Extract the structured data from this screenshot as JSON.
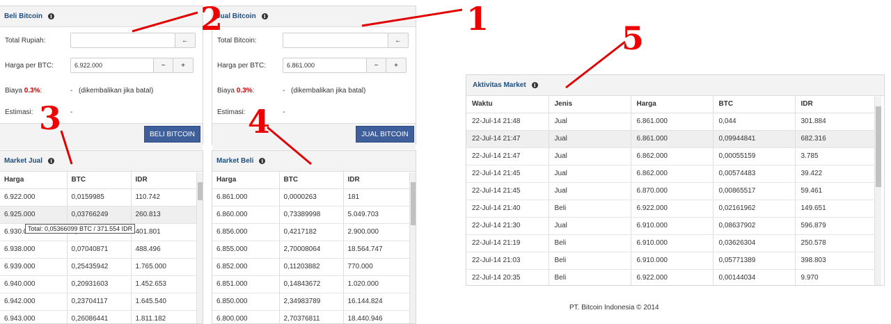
{
  "buy": {
    "title": "Beli Bitcoin",
    "total_label": "Total Rupiah:",
    "total_value": "",
    "price_label": "Harga per BTC:",
    "price_value": "6.922.000",
    "fee_label": "Biaya",
    "fee_pct": "0.3%",
    "fee_colon": ":",
    "fee_value": "-",
    "fee_note": "(dikembalikan jika batal)",
    "estimate_label": "Estimasi:",
    "estimate_value": "-",
    "button": "BELI BITCOIN"
  },
  "sell": {
    "title": "Jual Bitcoin",
    "total_label": "Total Bitcoin:",
    "total_value": "",
    "price_label": "Harga per BTC:",
    "price_value": "6.861.000",
    "fee_label": "Biaya",
    "fee_pct": "0.3%",
    "fee_colon": ":",
    "fee_value": "-",
    "fee_note": "(dikembalikan jika batal)",
    "estimate_label": "Estimasi:",
    "estimate_value": "-",
    "button": "JUAL BITCOIN"
  },
  "controls": {
    "arrow": "←",
    "minus": "−",
    "plus": "+",
    "info": "i"
  },
  "market_sell": {
    "title": "Market Jual",
    "headers": [
      "Harga",
      "BTC",
      "IDR"
    ],
    "rows": [
      [
        "6.922.000",
        "0,0159985",
        "110.742"
      ],
      [
        "6.925.000",
        "0,03766249",
        "260.813"
      ],
      [
        "6.930.000",
        "0,05366099",
        "401.801"
      ],
      [
        "6.938.000",
        "0,07040871",
        "488.496"
      ],
      [
        "6.939.000",
        "0,25435942",
        "1.765.000"
      ],
      [
        "6.940.000",
        "0,20931603",
        "1.452.653"
      ],
      [
        "6.942.000",
        "0,23704117",
        "1.645.540"
      ],
      [
        "6.943.000",
        "0,26086441",
        "1.811.182"
      ]
    ],
    "tooltip": "Total: 0,05366099 BTC / 371.554 IDR"
  },
  "market_buy": {
    "title": "Market Beli",
    "headers": [
      "Harga",
      "BTC",
      "IDR"
    ],
    "rows": [
      [
        "6.861.000",
        "0,0000263",
        "181"
      ],
      [
        "6.860.000",
        "0,73389998",
        "5.049.703"
      ],
      [
        "6.856.000",
        "0,4217182",
        "2.900.000"
      ],
      [
        "6.855.000",
        "2,70008064",
        "18.564.747"
      ],
      [
        "6.852.000",
        "0,11203882",
        "770.000"
      ],
      [
        "6.851.000",
        "0,14843672",
        "1.020.000"
      ],
      [
        "6.850.000",
        "2,34983789",
        "16.144.824"
      ],
      [
        "6.800.000",
        "2,70376811",
        "18.440.946"
      ]
    ]
  },
  "activity": {
    "title": "Aktivitas Market",
    "headers": [
      "Waktu",
      "Jenis",
      "Harga",
      "BTC",
      "IDR"
    ],
    "rows": [
      [
        "22-Jul-14 21:48",
        "Jual",
        "6.861.000",
        "0,044",
        "301.884"
      ],
      [
        "22-Jul-14 21:47",
        "Jual",
        "6.861.000",
        "0,09944841",
        "682.316"
      ],
      [
        "22-Jul-14 21:47",
        "Jual",
        "6.862.000",
        "0,00055159",
        "3.785"
      ],
      [
        "22-Jul-14 21:45",
        "Jual",
        "6.862.000",
        "0,00574483",
        "39.422"
      ],
      [
        "22-Jul-14 21:45",
        "Jual",
        "6.870.000",
        "0,00865517",
        "59.461"
      ],
      [
        "22-Jul-14 21:40",
        "Beli",
        "6.922.000",
        "0,02161962",
        "149.651"
      ],
      [
        "22-Jul-14 21:30",
        "Jual",
        "6.910.000",
        "0,08637902",
        "596.879"
      ],
      [
        "22-Jul-14 21:19",
        "Beli",
        "6.910.000",
        "0,03626304",
        "250.578"
      ],
      [
        "22-Jul-14 21:03",
        "Beli",
        "6.910.000",
        "0,05771389",
        "398.803"
      ],
      [
        "22-Jul-14 20:35",
        "Beli",
        "6.922.000",
        "0,00144034",
        "9.970"
      ]
    ]
  },
  "footer": "PT. Bitcoin Indonesia © 2014",
  "annotations": {
    "n1": "1",
    "n2": "2",
    "n3": "3",
    "n4": "4",
    "n5": "5"
  },
  "colors": {
    "annotation": "#e00000",
    "button": "#3e5f9c",
    "header": "#1d4f80",
    "fee": "#cc0000"
  }
}
